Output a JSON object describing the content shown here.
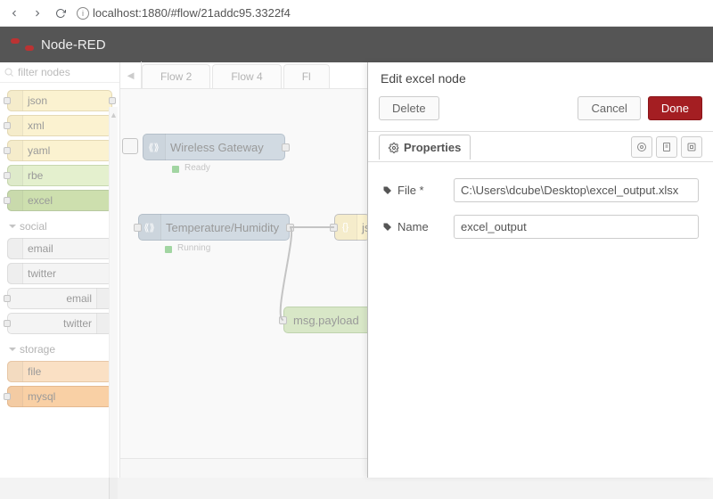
{
  "browser": {
    "url": "localhost:1880/#flow/21addc95.3322f4"
  },
  "header": {
    "title": "Node-RED"
  },
  "palette": {
    "filter_placeholder": "filter nodes",
    "groups": [
      {
        "items": [
          {
            "label": "json",
            "cls": "yellow",
            "io": "both"
          },
          {
            "label": "xml",
            "cls": "yellow",
            "io": "both"
          },
          {
            "label": "yaml",
            "cls": "yellow",
            "io": "both"
          },
          {
            "label": "rbe",
            "cls": "green",
            "io": "both"
          },
          {
            "label": "excel",
            "cls": "darkgreen",
            "io": "both"
          }
        ]
      },
      {
        "title": "social",
        "items": [
          {
            "label": "email",
            "cls": "grey",
            "io": "in"
          },
          {
            "label": "twitter",
            "cls": "grey",
            "io": "in"
          },
          {
            "label": "email",
            "cls": "grey",
            "io": "out"
          },
          {
            "label": "twitter",
            "cls": "grey",
            "io": "out"
          }
        ]
      },
      {
        "title": "storage",
        "items": [
          {
            "label": "file",
            "cls": "orange",
            "io": "in"
          },
          {
            "label": "mysql",
            "cls": "orange2",
            "io": "both"
          }
        ]
      }
    ]
  },
  "tabs": [
    "Flow 2",
    "Flow 4",
    "Fl"
  ],
  "flow_nodes": {
    "gateway": {
      "label": "Wireless Gateway",
      "status": "Ready",
      "statusColor": "#4a4"
    },
    "temphum": {
      "label": "Temperature/Humidity",
      "status": "Running",
      "statusColor": "#4a4"
    },
    "json": {
      "label": "jso"
    },
    "debug": {
      "label": "msg.payload"
    }
  },
  "edit": {
    "title": "Edit excel node",
    "delete": "Delete",
    "cancel": "Cancel",
    "done": "Done",
    "properties": "Properties",
    "file_label": "File *",
    "file_value": "C:\\Users\\dcube\\Desktop\\excel_output.xlsx",
    "name_label": "Name",
    "name_value": "excel_output"
  }
}
